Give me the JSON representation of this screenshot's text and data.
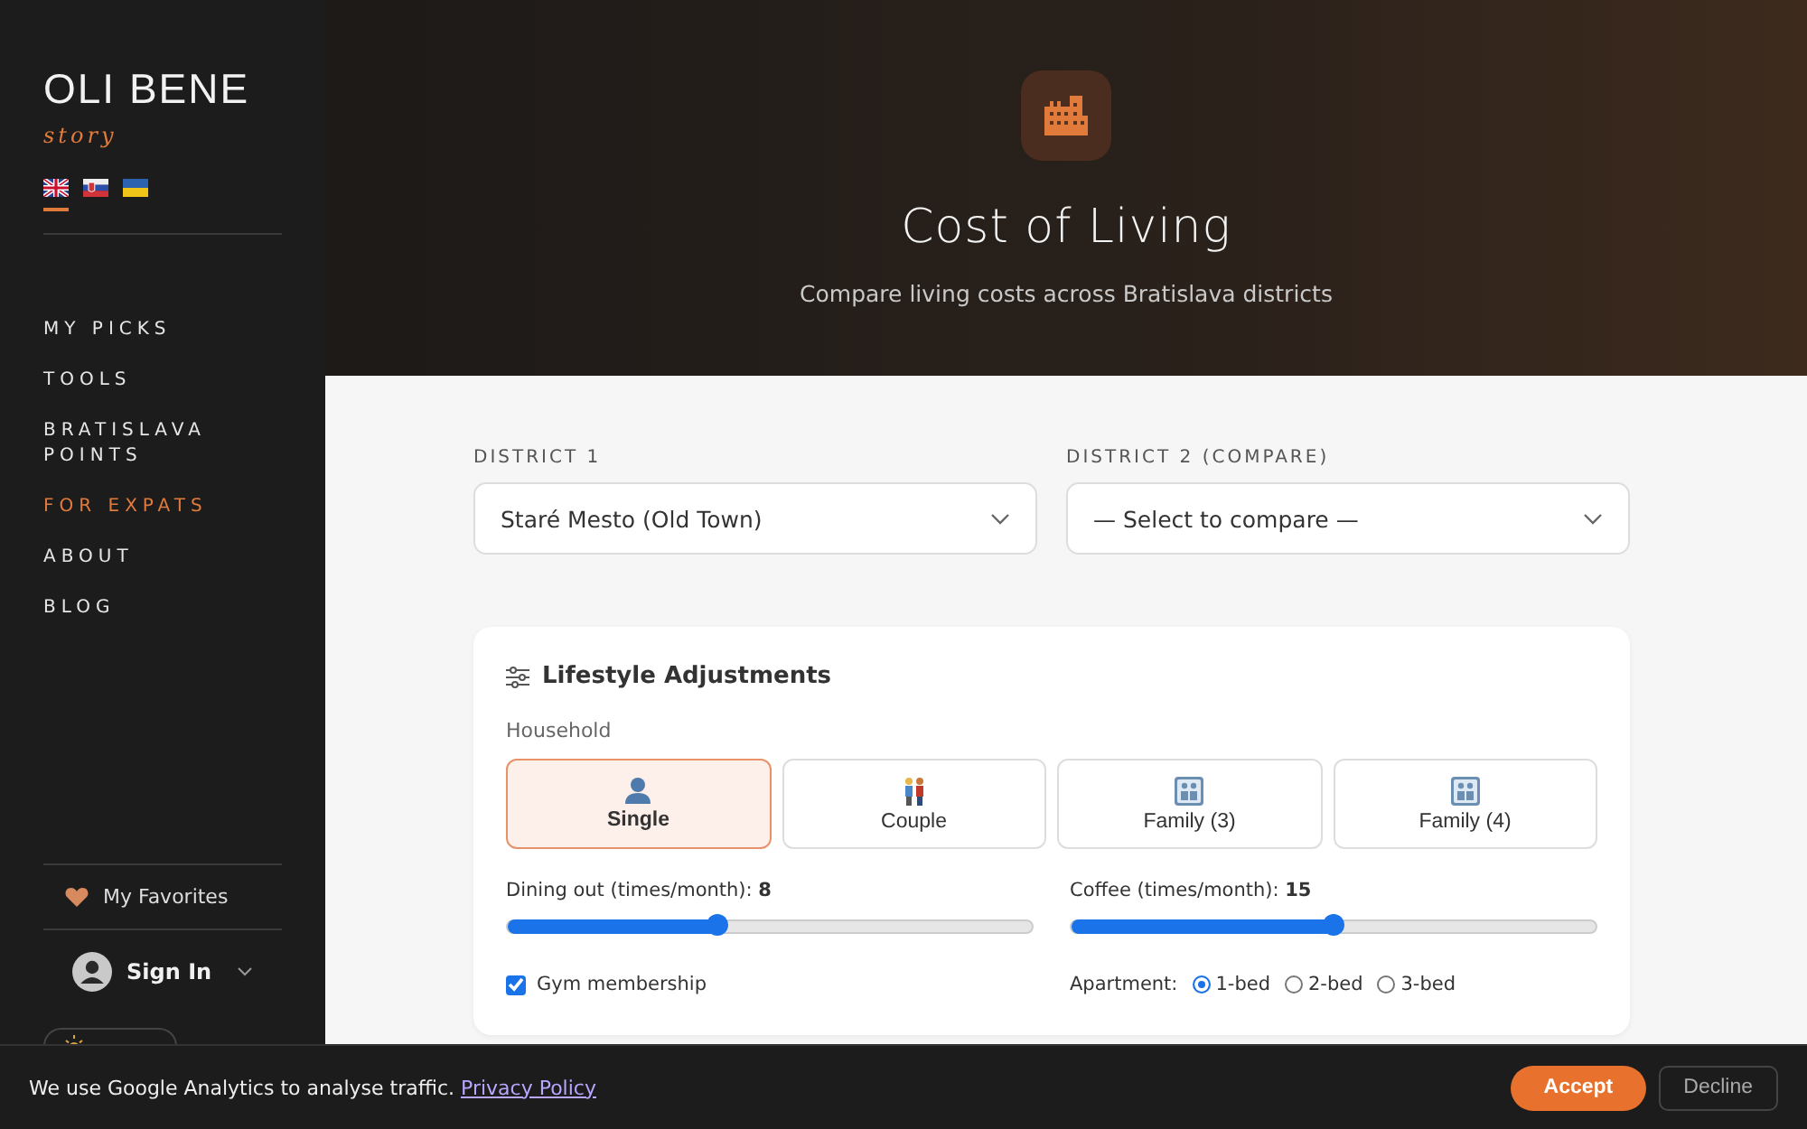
{
  "sidebar": {
    "logo": "OLI BENE",
    "logo_sub": "story",
    "languages": [
      {
        "kind": "uk",
        "selected": true
      },
      {
        "kind": "sk",
        "selected": false
      },
      {
        "kind": "ua",
        "selected": false
      }
    ],
    "nav": [
      {
        "label": "MY PICKS",
        "selected": false
      },
      {
        "label": "TOOLS",
        "selected": false
      },
      {
        "label": "BRATISLAVA POINTS",
        "selected": false
      },
      {
        "label": "FOR EXPATS",
        "selected": true
      },
      {
        "label": "ABOUT",
        "selected": false
      },
      {
        "label": "BLOG",
        "selected": false
      }
    ],
    "favorites": "My Favorites",
    "sign_in": "Sign In"
  },
  "hero": {
    "title": "Cost of Living",
    "subtitle": "Compare living costs across Bratislava districts"
  },
  "districts": [
    {
      "label": "DISTRICT 1",
      "value": "Staré Mesto (Old Town)"
    },
    {
      "label": "DISTRICT 2 (COMPARE)",
      "value": "— Select to compare —"
    }
  ],
  "lifestyle": {
    "title": "Lifestyle Adjustments",
    "household_label": "Household",
    "household": [
      {
        "kind": "single",
        "label": "Single",
        "selected": true
      },
      {
        "kind": "couple",
        "label": "Couple",
        "selected": false
      },
      {
        "kind": "family",
        "label": "Family (3)",
        "selected": false
      },
      {
        "kind": "family",
        "label": "Family (4)",
        "selected": false
      }
    ],
    "sliders": [
      {
        "label": "Dining out (times/month):",
        "reading": "8",
        "level": 0.4
      },
      {
        "label": "Coffee (times/month):",
        "reading": "15",
        "level": 0.5
      }
    ],
    "gym": {
      "label": "Gym membership",
      "checked": true
    },
    "apartment": {
      "label": "Apartment:",
      "options": [
        {
          "label": "1-bed",
          "selected": true
        },
        {
          "label": "2-bed",
          "selected": false
        },
        {
          "label": "3-bed",
          "selected": false
        }
      ]
    }
  },
  "cookie": {
    "text": "We use Google Analytics to analyse traffic.",
    "link": "Privacy Policy",
    "buttons": [
      "Accept",
      "Decline"
    ]
  }
}
